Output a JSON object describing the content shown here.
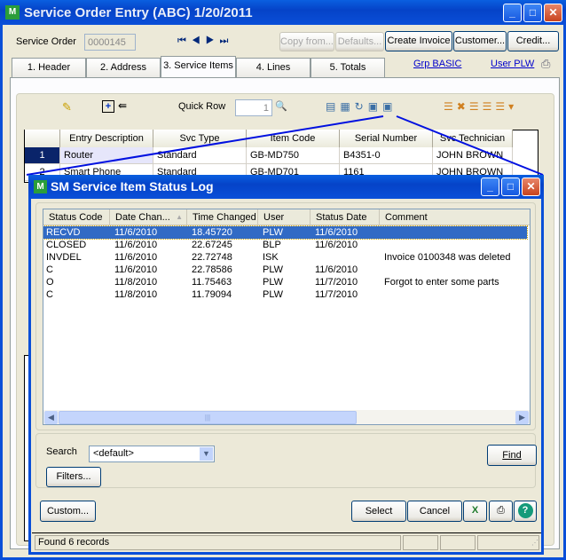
{
  "main": {
    "title": "Service Order Entry (ABC) 1/20/2011",
    "service_order_label": "Service Order",
    "service_order_value": "0000145",
    "buttons": {
      "copy_from": "Copy from...",
      "defaults": "Defaults...",
      "create_invoice": "Create Invoice",
      "customer": "Customer...",
      "credit": "Credit..."
    },
    "tabs": [
      {
        "label": "1. Header"
      },
      {
        "label": "2. Address"
      },
      {
        "label": "3. Service Items"
      },
      {
        "label": "4. Lines"
      },
      {
        "label": "5. Totals"
      }
    ],
    "active_tab": "3. Service Items",
    "links": {
      "grp": "Grp BASIC",
      "user": "User PLW"
    },
    "quick_row_label": "Quick Row",
    "quick_row_value": "1",
    "grid": {
      "headers": [
        "Entry Description",
        "Svc Type",
        "Item Code",
        "Serial Number",
        "Svc Technician"
      ],
      "rows": [
        {
          "num": "1",
          "cells": [
            "Router",
            "Standard",
            "GB-MD750",
            "B4351-0",
            "JOHN BROWN"
          ]
        },
        {
          "num": "2",
          "cells": [
            "Smart Phone",
            "Standard",
            "GB-MD701",
            "1161",
            "JOHN BROWN"
          ]
        }
      ]
    }
  },
  "dialog": {
    "title": "SM Service Item Status Log",
    "columns": [
      "Status Code",
      "Date Chan...",
      "Time Changed",
      "User",
      "Status Date",
      "Comment"
    ],
    "rows": [
      [
        "RECVD",
        "11/6/2010",
        "18.45720",
        "PLW",
        "11/6/2010",
        ""
      ],
      [
        "CLOSED",
        "11/6/2010",
        "22.67245",
        "BLP",
        "11/6/2010",
        ""
      ],
      [
        "INVDEL",
        "11/6/2010",
        "22.72748",
        "ISK",
        "",
        "Invoice 0100348 was deleted"
      ],
      [
        "C",
        "11/6/2010",
        "22.78586",
        "PLW",
        "11/6/2010",
        ""
      ],
      [
        "O",
        "11/8/2010",
        "11.75463",
        "PLW",
        "11/7/2010",
        "Forgot to enter some parts"
      ],
      [
        "C",
        "11/8/2010",
        "11.79094",
        "PLW",
        "11/7/2010",
        ""
      ]
    ],
    "selected_row": 0,
    "search_label": "Search",
    "search_value": "<default>",
    "find": "Find",
    "filters": "Filters...",
    "custom": "Custom...",
    "select": "Select",
    "cancel": "Cancel",
    "status": "Found 6 records"
  },
  "colors": {
    "titlebar": "#0a4fd8",
    "selection": "#316ac5",
    "link": "#0000cc"
  }
}
